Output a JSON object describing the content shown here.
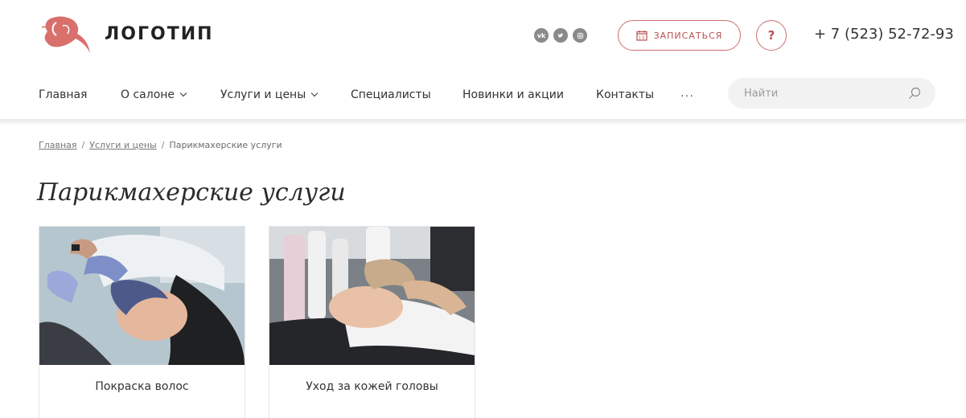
{
  "header": {
    "logo_text": "ЛОГОТИП",
    "socials": [
      "vk-icon",
      "twitter-icon",
      "instagram-icon"
    ],
    "book_label": "ЗАПИСАТЬСЯ",
    "help_label": "?",
    "phone": "+ 7 (523) 52-72-93"
  },
  "nav": {
    "items": [
      {
        "label": "Главная"
      },
      {
        "label": "О салоне"
      },
      {
        "label": "Услуги и цены"
      },
      {
        "label": "Специалисты"
      },
      {
        "label": "Новинки и акции"
      },
      {
        "label": "Контакты"
      }
    ],
    "more": "···"
  },
  "search": {
    "placeholder": "Найти"
  },
  "breadcrumb": {
    "items": [
      "Главная",
      "Услуги и цены",
      "Парикмахерские услуги"
    ],
    "separator": "/"
  },
  "page": {
    "title": "Парикмахерские услуги"
  },
  "cards": [
    {
      "label": "Покраска волос"
    },
    {
      "label": "Уход за кожей головы"
    }
  ],
  "colors": {
    "accent": "#c9716f",
    "accent_text": "#b8524f"
  }
}
